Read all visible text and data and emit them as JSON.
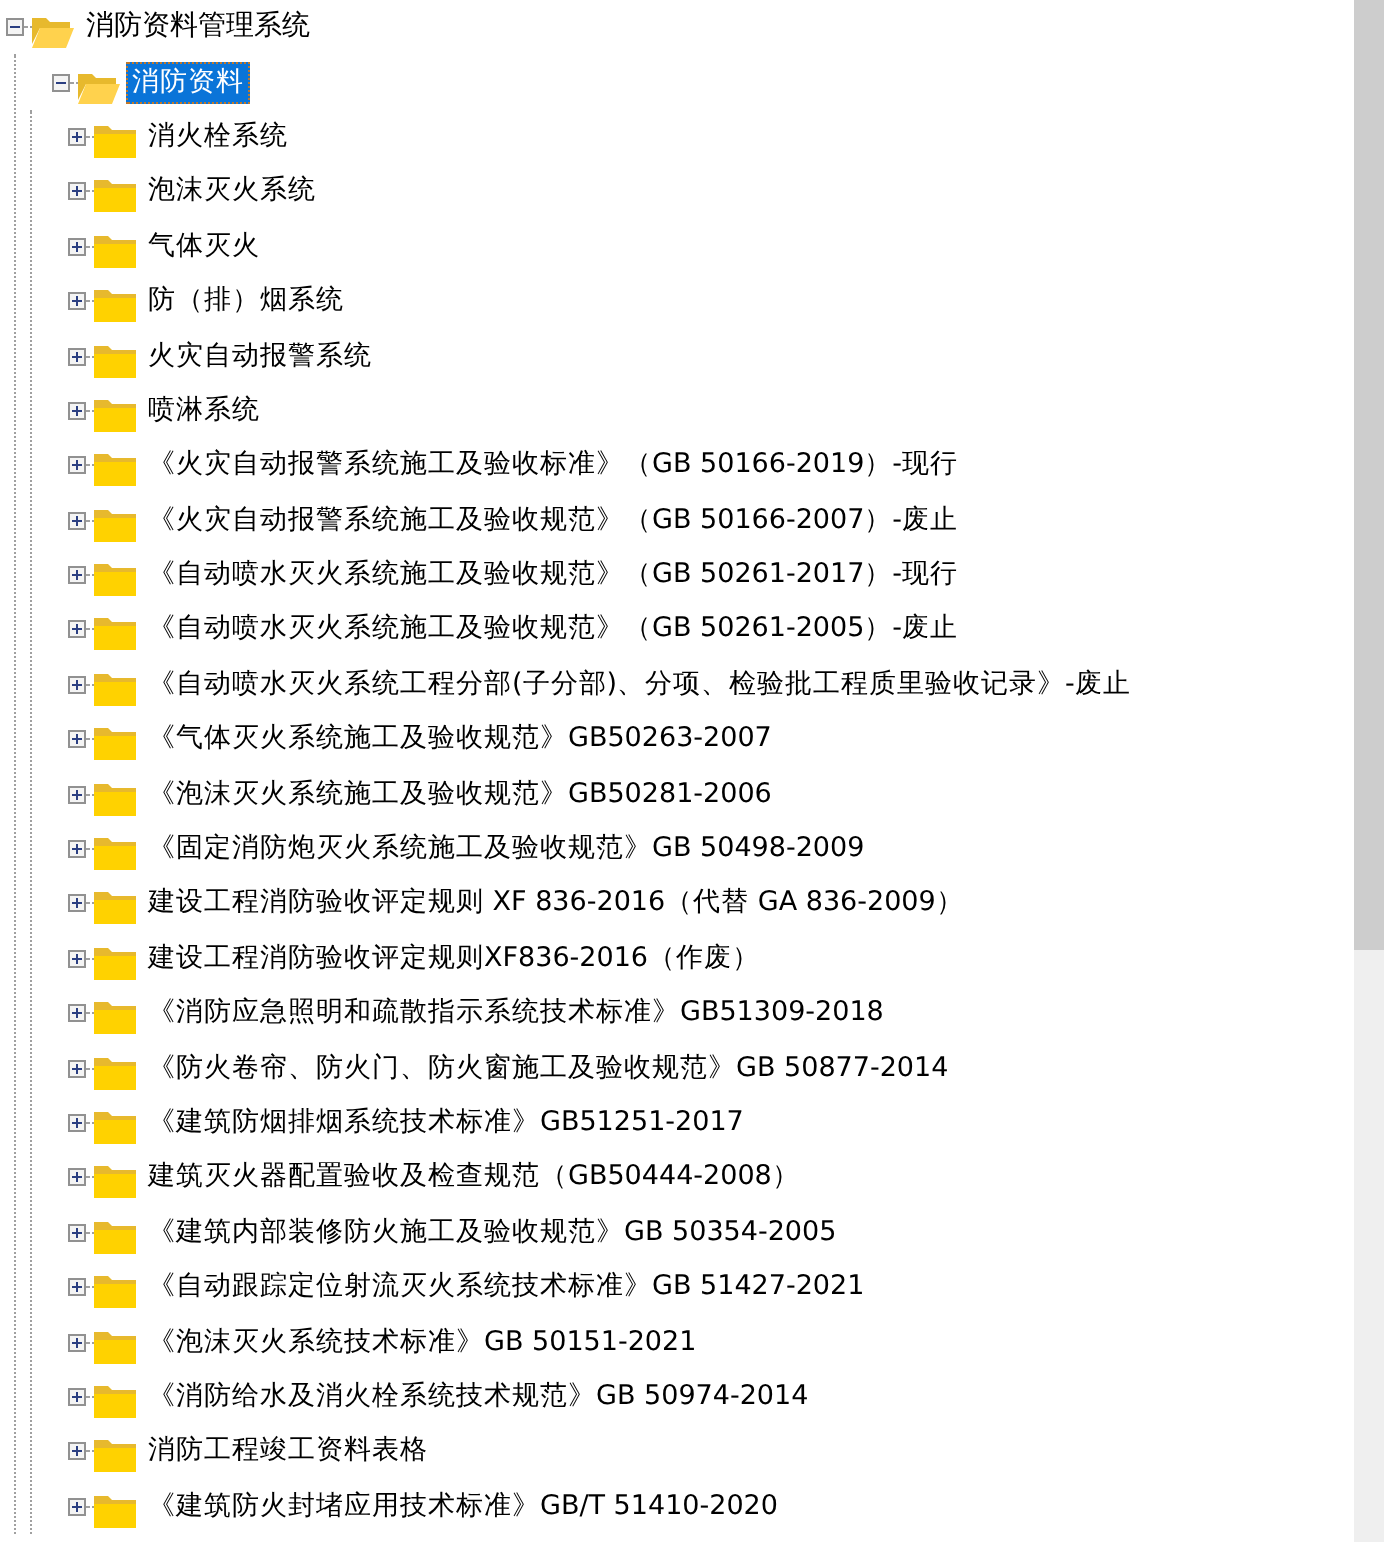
{
  "tree": [
    {
      "label": "消防资料管理系统",
      "expanded": true,
      "selected": false,
      "children": [
        {
          "label": "消防资料",
          "expanded": true,
          "selected": true,
          "children": [
            {
              "label": "消火栓系统",
              "expanded": false,
              "selected": false
            },
            {
              "label": "泡沫灭火系统",
              "expanded": false,
              "selected": false
            },
            {
              "label": "气体灭火",
              "expanded": false,
              "selected": false
            },
            {
              "label": "防（排）烟系统",
              "expanded": false,
              "selected": false
            },
            {
              "label": "火灾自动报警系统",
              "expanded": false,
              "selected": false
            },
            {
              "label": "喷淋系统",
              "expanded": false,
              "selected": false
            },
            {
              "label": "《火灾自动报警系统施工及验收标准》（GB 50166-2019）-现行",
              "expanded": false,
              "selected": false
            },
            {
              "label": "《火灾自动报警系统施工及验收规范》（GB 50166-2007）-废止",
              "expanded": false,
              "selected": false
            },
            {
              "label": "《自动喷水灭火系统施工及验收规范》（GB 50261-2017）-现行",
              "expanded": false,
              "selected": false
            },
            {
              "label": "《自动喷水灭火系统施工及验收规范》（GB 50261-2005）-废止",
              "expanded": false,
              "selected": false
            },
            {
              "label": "《自动喷水灭火系统工程分部(子分部)、分项、检验批工程质里验收记录》-废止",
              "expanded": false,
              "selected": false
            },
            {
              "label": "《气体灭火系统施工及验收规范》GB50263-2007",
              "expanded": false,
              "selected": false
            },
            {
              "label": "《泡沫灭火系统施工及验收规范》GB50281-2006",
              "expanded": false,
              "selected": false
            },
            {
              "label": "《固定消防炮灭火系统施工及验收规范》GB 50498-2009",
              "expanded": false,
              "selected": false
            },
            {
              "label": "建设工程消防验收评定规则 XF 836-2016（代替 GA 836-2009）",
              "expanded": false,
              "selected": false
            },
            {
              "label": "建设工程消防验收评定规则XF836-2016（作废）",
              "expanded": false,
              "selected": false
            },
            {
              "label": "《消防应急照明和疏散指示系统技术标准》GB51309-2018",
              "expanded": false,
              "selected": false
            },
            {
              "label": "《防火卷帘、防火门、防火窗施工及验收规范》GB 50877-2014",
              "expanded": false,
              "selected": false
            },
            {
              "label": "《建筑防烟排烟系统技术标准》GB51251-2017",
              "expanded": false,
              "selected": false
            },
            {
              "label": "建筑灭火器配置验收及检查规范（GB50444-2008）",
              "expanded": false,
              "selected": false
            },
            {
              "label": "《建筑内部装修防火施工及验收规范》GB 50354-2005",
              "expanded": false,
              "selected": false
            },
            {
              "label": "《自动跟踪定位射流灭火系统技术标准》GB 51427-2021",
              "expanded": false,
              "selected": false
            },
            {
              "label": "《泡沫灭火系统技术标准》GB 50151-2021",
              "expanded": false,
              "selected": false
            },
            {
              "label": "《消防给水及消火栓系统技术规范》GB 50974-2014",
              "expanded": false,
              "selected": false
            },
            {
              "label": "消防工程竣工资料表格",
              "expanded": false,
              "selected": false
            },
            {
              "label": "《建筑防火封堵应用技术标准》GB/T 51410-2020",
              "expanded": false,
              "selected": false
            }
          ]
        }
      ]
    }
  ]
}
